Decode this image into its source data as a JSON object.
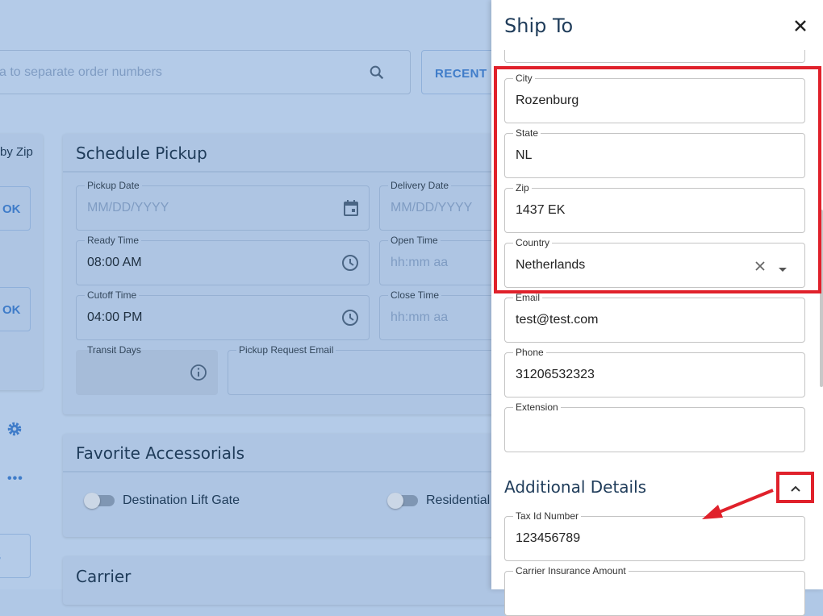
{
  "background": {
    "search_placeholder": "a to separate order numbers",
    "recent_button": "RECENT O",
    "by_zip_label": "by Zip",
    "ok_label_1": "OK",
    "ok_label_2": "OK",
    "side_button_3": "S",
    "schedule_title": "Schedule Pickup",
    "pickup_date": {
      "label": "Pickup Date",
      "placeholder": "MM/DD/YYYY"
    },
    "delivery_date": {
      "label": "Delivery Date",
      "placeholder": "MM/DD/YYYY"
    },
    "ready_time": {
      "label": "Ready Time",
      "value": "08:00 AM"
    },
    "open_time": {
      "label": "Open Time",
      "placeholder": "hh:mm aa"
    },
    "cutoff_time": {
      "label": "Cutoff Time",
      "value": "04:00 PM"
    },
    "close_time": {
      "label": "Close Time",
      "placeholder": "hh:mm aa"
    },
    "transit_days": {
      "label": "Transit Days"
    },
    "pickup_email": {
      "label": "Pickup Request Email"
    },
    "favorites_title": "Favorite Accessorials",
    "toggle_1": "Destination Lift Gate",
    "toggle_2": "Residential",
    "carrier_title": "Carrier"
  },
  "drawer": {
    "title": "Ship To",
    "fields": {
      "city": {
        "label": "City",
        "value": "Rozenburg"
      },
      "state": {
        "label": "State",
        "value": "NL"
      },
      "zip": {
        "label": "Zip",
        "value": "1437 EK"
      },
      "country": {
        "label": "Country",
        "value": "Netherlands"
      },
      "email": {
        "label": "Email",
        "value": "test@test.com"
      },
      "phone": {
        "label": "Phone",
        "value": "31206532323"
      },
      "extension": {
        "label": "Extension",
        "value": ""
      },
      "tax_id": {
        "label": "Tax Id Number",
        "value": "123456789"
      },
      "carrier_insurance": {
        "label": "Carrier Insurance Amount",
        "value": ""
      }
    },
    "additional_details_title": "Additional Details"
  },
  "colors": {
    "annotation_red": "#e0212b",
    "accent_blue": "#3f7cc9"
  }
}
